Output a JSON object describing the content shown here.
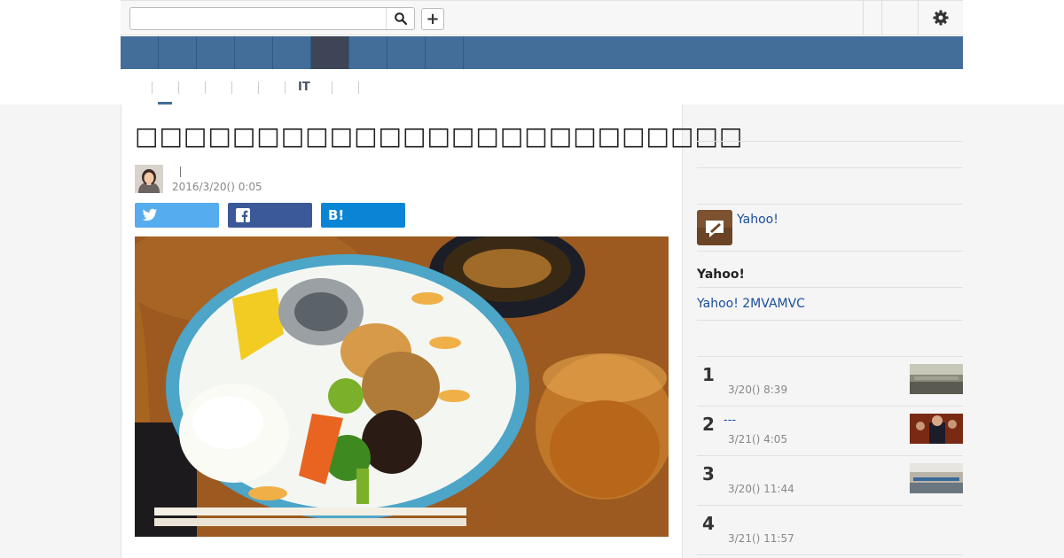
{
  "search": {
    "placeholder": "",
    "value": ""
  },
  "toolbar": {
    "plus_label": "+"
  },
  "subnav": {
    "items": [
      "",
      "",
      "",
      "",
      "",
      "IT",
      "",
      ""
    ]
  },
  "article": {
    "title": "□□□□□□□□□□□□□□□□□□□□□□□□□",
    "author": "",
    "date": "2016/3/20() 0:05"
  },
  "share": {
    "twitter_label": "",
    "facebook_label": "",
    "hatena_label": "B!"
  },
  "sidebar": {
    "pro_link": "Yahoo!",
    "heading": "Yahoo!",
    "link": "Yahoo! 2MVAMVC",
    "ranking": [
      {
        "rank": "1",
        "title": "",
        "time": "3/20() 8:39"
      },
      {
        "rank": "2",
        "title": "---",
        "time": "3/21() 4:05"
      },
      {
        "rank": "3",
        "title": "",
        "time": "3/20() 11:44"
      },
      {
        "rank": "4",
        "title": "",
        "time": "3/21() 11:57"
      }
    ]
  },
  "colors": {
    "nav": "#436e99",
    "nav_active": "#3d4556",
    "twitter": "#55acee",
    "facebook": "#3b5998",
    "hatena": "#0a85d6",
    "link": "#1a4e9a"
  }
}
